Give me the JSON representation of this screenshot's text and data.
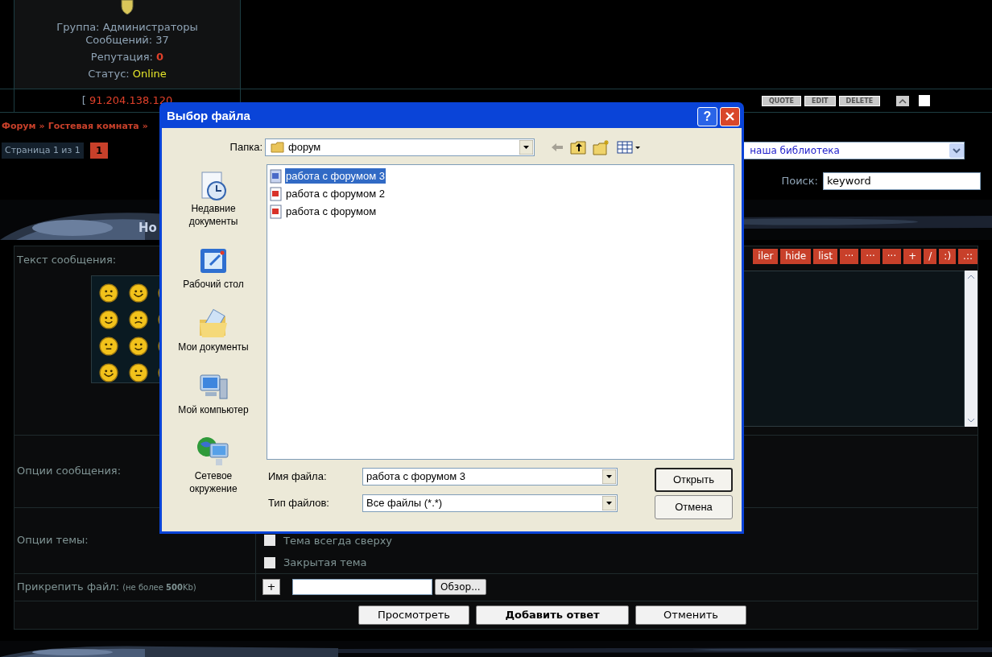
{
  "user_panel": {
    "lines": [
      {
        "label": "Группа:",
        "value": "Администраторы",
        "kind": "plain"
      },
      {
        "label": "Сообщений:",
        "value": "37",
        "kind": "plain"
      },
      {
        "label": "Репутация:",
        "value": "0",
        "kind": "danger"
      },
      {
        "label": "Статус:",
        "value": "Online",
        "kind": "online"
      }
    ],
    "ip": {
      "open": "[",
      "address": "91.204.138.120"
    }
  },
  "select_post": {
    "checked": false
  },
  "post_buttons": [
    "QUOTE",
    "EDIT",
    "DELETE"
  ],
  "breadcrumb": [
    "Форум",
    "»",
    "Гостевая комната",
    "»"
  ],
  "pagination": {
    "label": "Страница 1 из 1",
    "pages": [
      {
        "label": "1",
        "selected": true
      }
    ]
  },
  "jump": {
    "value": "наша библиотека"
  },
  "search": {
    "label": "Поиск:",
    "value": "keyword"
  },
  "form": {
    "title": "Но",
    "message_label": "Текст сообщения:",
    "toolbar": [
      "iler",
      "hide",
      "list",
      "···",
      "···",
      "···",
      "+",
      "/",
      ":)",
      ".::"
    ],
    "message_options_label": "Опции сообщения:",
    "topic_options": {
      "label": "Опции темы:",
      "options": [
        {
          "label": "Тема всегда сверху",
          "checked": false
        },
        {
          "label": "Закрытая тема",
          "checked": false
        }
      ]
    },
    "attach": {
      "label": "Прикрепить файл:",
      "note": "(не более **500**Kb)",
      "add": "+",
      "browse": "Обзор..."
    },
    "actions": [
      {
        "label": "Просмотреть",
        "primary": false
      },
      {
        "label": "Добавить ответ",
        "primary": true
      },
      {
        "label": "Отменить",
        "primary": false
      }
    ]
  },
  "dialog": {
    "title": "Выбор файла",
    "help": "?",
    "folder_label": "Папка:",
    "folder": "форум",
    "places": [
      {
        "label": "Недавние документы",
        "kind": "recent"
      },
      {
        "label": "Рабочий стол",
        "kind": "desktop"
      },
      {
        "label": "Мои документы",
        "kind": "documents"
      },
      {
        "label": "Мой компьютер",
        "kind": "computer"
      },
      {
        "label": "Сетевое окружение",
        "kind": "network"
      }
    ],
    "files": [
      {
        "name": "работа с форумом 3",
        "selected": true
      },
      {
        "name": "работа с форумом 2",
        "selected": false
      },
      {
        "name": "работа с форумом",
        "selected": false
      }
    ],
    "filename_label": "Имя файла:",
    "filename": "работа с форумом 3",
    "type_label": "Тип файлов:",
    "type": "Все файлы (*.*)",
    "open": "Открыть",
    "cancel": "Отмена"
  }
}
